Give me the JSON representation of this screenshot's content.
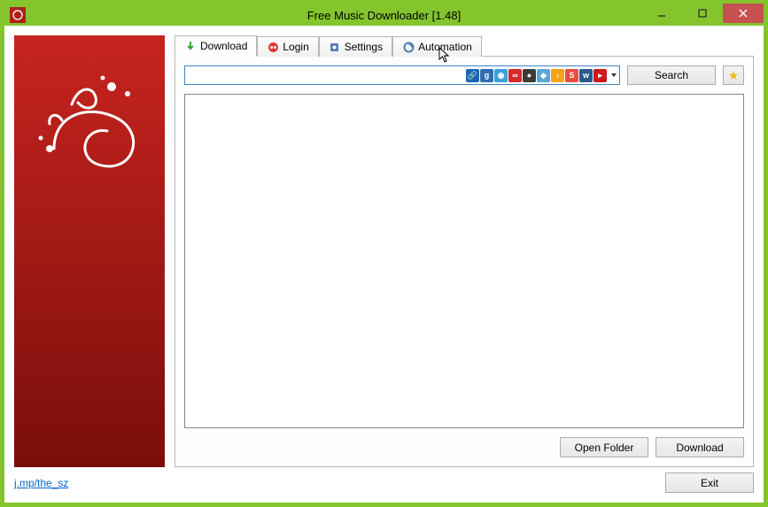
{
  "window": {
    "title": "Free Music Downloader [1.48]"
  },
  "tabs": {
    "download": "Download",
    "login": "Login",
    "settings": "Settings",
    "automation": "Automation"
  },
  "search": {
    "value": "",
    "placeholder": "",
    "button": "Search"
  },
  "sources": [
    {
      "name": "link",
      "bg": "#1e64b4",
      "glyph": "🔗"
    },
    {
      "name": "grooveshark",
      "bg": "#2f6fb0",
      "glyph": "g"
    },
    {
      "name": "soundcloud",
      "bg": "#3aa1d9",
      "glyph": "◉"
    },
    {
      "name": "lastfm",
      "bg": "#d32a2a",
      "glyph": "∞"
    },
    {
      "name": "mixcloud",
      "bg": "#3b3b3b",
      "glyph": "●"
    },
    {
      "name": "bandcamp",
      "bg": "#5aa8d6",
      "glyph": "◆"
    },
    {
      "name": "jamendo",
      "bg": "#f7a11a",
      "glyph": "♪"
    },
    {
      "name": "songr",
      "bg": "#e84c3d",
      "glyph": "S"
    },
    {
      "name": "vk",
      "bg": "#2b5a8f",
      "glyph": "w"
    },
    {
      "name": "youtube",
      "bg": "#cc181e",
      "glyph": "▸"
    }
  ],
  "buttons": {
    "open_folder": "Open Folder",
    "download": "Download",
    "exit": "Exit"
  },
  "footer": {
    "link": "j.mp/the_sz"
  }
}
